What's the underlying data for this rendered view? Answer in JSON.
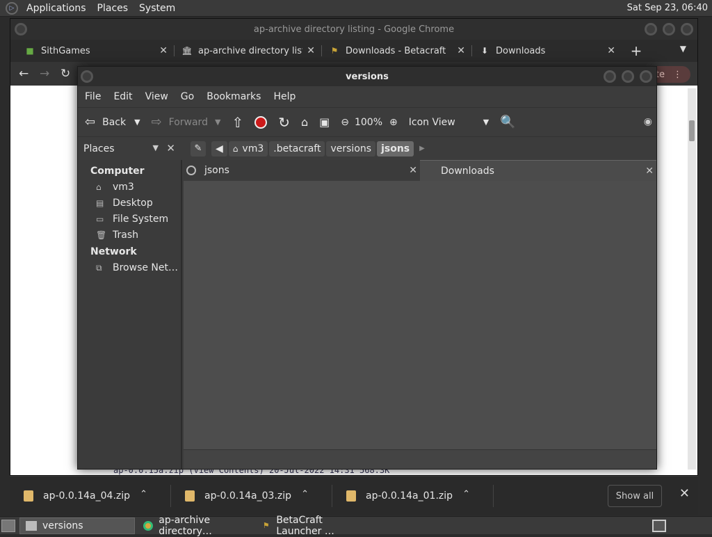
{
  "top_panel": {
    "menus": [
      "Applications",
      "Places",
      "System"
    ],
    "clock": "Sat Sep 23, 06:40"
  },
  "chrome": {
    "title": "ap-archive directory listing - Google Chrome",
    "tabs": [
      {
        "label": "SithGames",
        "icon": "minecraft-block-icon"
      },
      {
        "label": "ap-archive directory listin",
        "icon": "archive-building-icon"
      },
      {
        "label": "Downloads - Betacraft",
        "icon": "betacraft-icon"
      },
      {
        "label": "Downloads",
        "icon": "download-icon"
      }
    ],
    "update_label": "date",
    "page_line": "ap-0.0.15a.zip (View Contents)          20-Jul-2022 14:31     568.3K"
  },
  "file_manager": {
    "title": "versions",
    "menus": [
      "File",
      "Edit",
      "View",
      "Go",
      "Bookmarks",
      "Help"
    ],
    "toolbar": {
      "back": "Back",
      "forward": "Forward",
      "zoom": "100%",
      "view_mode": "Icon View"
    },
    "places_label": "Places",
    "breadcrumbs": [
      "vm3",
      ".betacraft",
      "versions",
      "jsons"
    ],
    "sidebar": {
      "computer_heading": "Computer",
      "computer_items": [
        "vm3",
        "Desktop",
        "File System",
        "Trash"
      ],
      "network_heading": "Network",
      "network_items": [
        "Browse Net…"
      ]
    },
    "pane_left_tab": "jsons",
    "pane_right_tab": "Downloads"
  },
  "downloads": {
    "items": [
      "ap-0.0.14a_04.zip",
      "ap-0.0.14a_03.zip",
      "ap-0.0.14a_01.zip"
    ],
    "show_all": "Show all"
  },
  "taskbar": {
    "items": [
      "versions",
      "ap-archive directory…",
      "BetaCraft Launcher …"
    ]
  }
}
